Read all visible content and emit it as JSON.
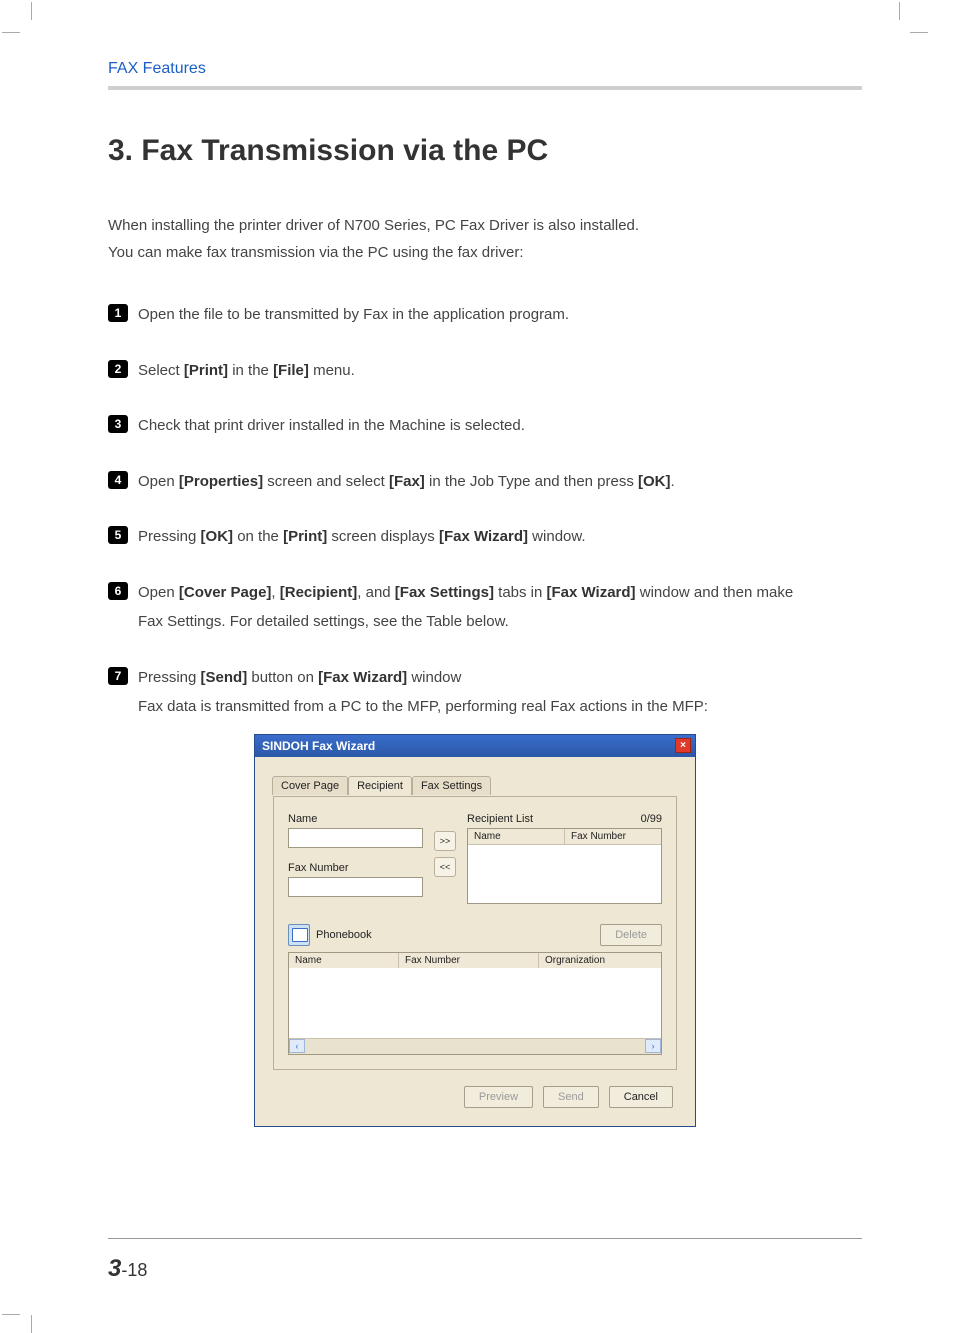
{
  "header": {
    "section_label": "FAX Features"
  },
  "title": "3. Fax Transmission via the PC",
  "intro": {
    "line1": "When installing the printer driver of N700 Series, PC Fax Driver is also installed.",
    "line2": "You can make fax transmission via the PC using the fax driver:"
  },
  "steps": {
    "s1": {
      "num": "1",
      "text": "Open the file to be transmitted by Fax in the application program."
    },
    "s2": {
      "num": "2",
      "pre": "Select ",
      "b1": "[Print]",
      "mid": " in the ",
      "b2": "[File]",
      "post": " menu."
    },
    "s3": {
      "num": "3",
      "text": "Check that print driver installed in the Machine is selected."
    },
    "s4": {
      "num": "4",
      "pre": "Open ",
      "b1": "[Properties]",
      "mid1": " screen and select ",
      "b2": "[Fax]",
      "mid2": " in the Job Type and then press ",
      "b3": "[OK]",
      "post": "."
    },
    "s5": {
      "num": "5",
      "pre": "Pressing ",
      "b1": "[OK]",
      "mid1": " on the ",
      "b2": "[Print]",
      "mid2": " screen displays ",
      "b3": "[Fax Wizard]",
      "post": " window."
    },
    "s6": {
      "num": "6",
      "pre": "Open ",
      "b1": "[Cover Page]",
      "c1": ", ",
      "b2": "[Recipient]",
      "c2": ", and ",
      "b3": "[Fax Settings]",
      "mid": " tabs in ",
      "b4": "[Fax Wizard]",
      "post": " window and then make",
      "line2": "Fax Settings. For detailed settings, see the Table below."
    },
    "s7": {
      "num": "7",
      "pre": "Pressing ",
      "b1": "[Send]",
      "mid": " button on ",
      "b2": "[Fax Wizard]",
      "post": " window",
      "line2": "Fax data is transmitted from a PC to the MFP, performing real Fax actions in the MFP:"
    }
  },
  "wizard": {
    "title": "SINDOH Fax Wizard",
    "tabs": {
      "cover": "Cover Page",
      "recipient": "Recipient",
      "settings": "Fax Settings"
    },
    "labels": {
      "name": "Name",
      "fax_number": "Fax Number",
      "recipient_list": "Recipient List",
      "count": "0/99",
      "phonebook": "Phonebook"
    },
    "columns": {
      "name": "Name",
      "fax_number": "Fax Number",
      "organization": "Orgranization"
    },
    "buttons": {
      "add": ">>",
      "remove": "<<",
      "delete": "Delete",
      "preview": "Preview",
      "send": "Send",
      "cancel": "Cancel",
      "close": "×",
      "scroll_left": "‹",
      "scroll_right": "›"
    }
  },
  "page_number": {
    "chapter": "3",
    "sep": "-",
    "page": "18"
  }
}
